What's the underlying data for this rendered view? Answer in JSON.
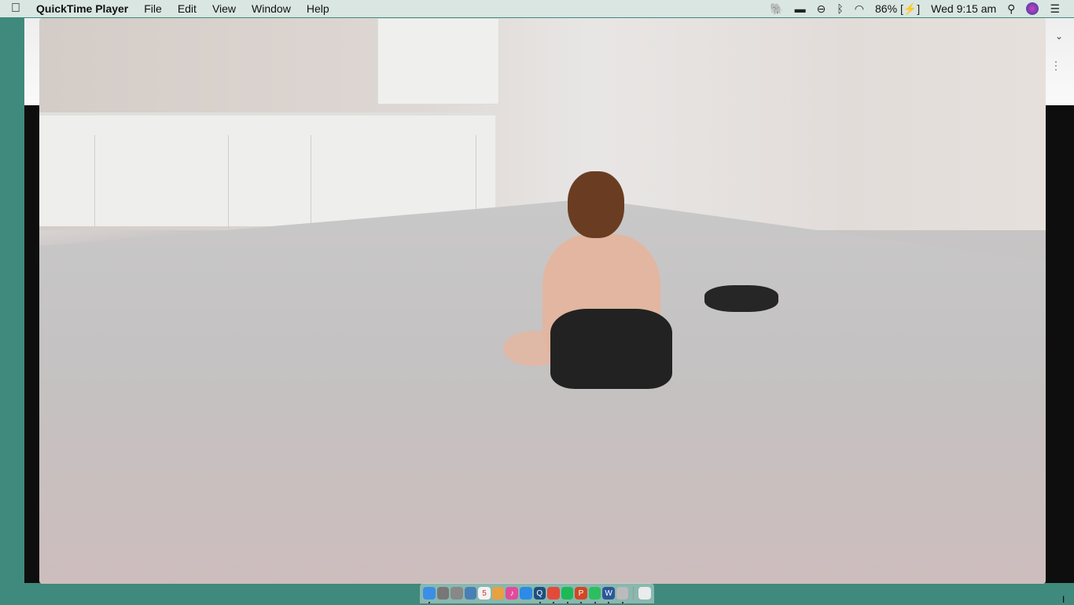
{
  "menubar": {
    "app": "QuickTime Player",
    "items": [
      "File",
      "Edit",
      "View",
      "Window",
      "Help"
    ],
    "status": {
      "battery": "86%",
      "clock": "Wed 9:15 am"
    }
  },
  "dock": [
    {
      "name": "finder",
      "label": "",
      "color": "#3a8ee6",
      "running": true
    },
    {
      "name": "system-preferences",
      "label": "",
      "color": "#777",
      "running": false
    },
    {
      "name": "launchpad",
      "label": "",
      "color": "#888",
      "running": false
    },
    {
      "name": "preview",
      "label": "",
      "color": "#4a7fb5",
      "running": false
    },
    {
      "name": "calendar",
      "label": "5",
      "color": "#f2f2f2",
      "running": false
    },
    {
      "name": "photos",
      "label": "",
      "color": "#e8a040",
      "running": false
    },
    {
      "name": "itunes",
      "label": "♪",
      "color": "#e14b9a",
      "running": false
    },
    {
      "name": "safari",
      "label": "",
      "color": "#2d8ae6",
      "running": false
    },
    {
      "name": "quicktime",
      "label": "Q",
      "color": "#1d4e80",
      "running": true
    },
    {
      "name": "chrome",
      "label": "",
      "color": "#e44a3a",
      "running": true
    },
    {
      "name": "spotify",
      "label": "",
      "color": "#1db954",
      "running": true
    },
    {
      "name": "powerpoint",
      "label": "P",
      "color": "#d24726",
      "running": true
    },
    {
      "name": "evernote",
      "label": "",
      "color": "#2dbe60",
      "running": true
    },
    {
      "name": "word",
      "label": "W",
      "color": "#2b579a",
      "running": true
    },
    {
      "name": "image-app",
      "label": "",
      "color": "#bbb",
      "running": true
    }
  ]
}
